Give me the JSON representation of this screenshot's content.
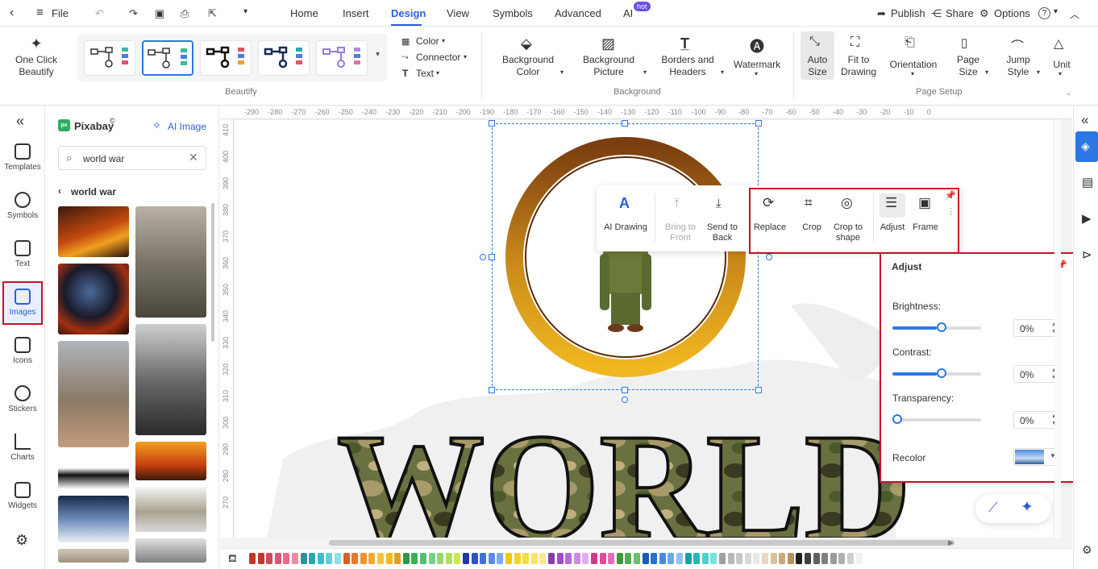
{
  "menu": {
    "file": "File",
    "tabs": [
      "Home",
      "Insert",
      "Design",
      "View",
      "Symbols",
      "Advanced",
      "AI"
    ],
    "hot_badge": "hot",
    "publish": "Publish",
    "share": "Share",
    "options": "Options",
    "help": "?"
  },
  "ribbon": {
    "one_click_beautify": [
      "One Click",
      "Beautify"
    ],
    "beautify_group": "Beautify",
    "color": "Color",
    "connector": "Connector",
    "text": "Text",
    "background_color": [
      "Background",
      "Color"
    ],
    "background_picture": [
      "Background",
      "Picture"
    ],
    "borders_headers": [
      "Borders and",
      "Headers"
    ],
    "watermark": "Watermark",
    "background_group": "Background",
    "auto_size": [
      "Auto",
      "Size"
    ],
    "fit_to_drawing": [
      "Fit to",
      "Drawing"
    ],
    "orientation": "Orientation",
    "page_size": [
      "Page",
      "Size"
    ],
    "jump_style": [
      "Jump",
      "Style"
    ],
    "unit": "Unit",
    "page_setup_group": "Page Setup"
  },
  "rail": {
    "items": [
      "Templates",
      "Symbols",
      "Text",
      "Images",
      "Icons",
      "Stickers",
      "Charts",
      "Widgets"
    ]
  },
  "panel": {
    "brand": "Pixabay",
    "ai_image": "AI Image",
    "search_value": "world war",
    "breadcrumb": "world war"
  },
  "ruler": {
    "top": [
      "-290",
      "-280",
      "-270",
      "-260",
      "-250",
      "-240",
      "-230",
      "-220",
      "-210",
      "-200",
      "-190",
      "-180",
      "-170",
      "-160",
      "-150",
      "-140",
      "-130",
      "-120",
      "-110",
      "-100",
      "-90",
      "-80",
      "-70",
      "-60",
      "-50",
      "-40",
      "-30",
      "-20",
      "-10",
      "0"
    ],
    "left": [
      "410",
      "400",
      "390",
      "380",
      "370",
      "360",
      "350",
      "340",
      "330",
      "320",
      "310",
      "300",
      "290",
      "280",
      "270"
    ]
  },
  "canvas_text": {
    "world": "WORLD"
  },
  "floatbar": {
    "ai_drawing": "AI Drawing",
    "bring_to_front": [
      "Bring to",
      "Front"
    ],
    "send_to_back": [
      "Send to",
      "Back"
    ],
    "replace": "Replace",
    "crop": "Crop",
    "crop_to_shape": [
      "Crop to",
      "shape"
    ],
    "adjust": "Adjust",
    "frame": "Frame"
  },
  "adjust": {
    "title": "Adjust",
    "brightness_label": "Brightness:",
    "brightness_value": "0%",
    "brightness_level": 0.5,
    "contrast_label": "Contrast:",
    "contrast_value": "0%",
    "contrast_level": 0.5,
    "transparency_label": "Transparency:",
    "transparency_value": "0%",
    "transparency_level": 0,
    "recolor_label": "Recolor"
  },
  "colors": {
    "accent": "#2b5fd9",
    "highlight_box": "#c8102e",
    "palette": [
      "#c0392b",
      "#c0392b",
      "#d14a5a",
      "#e05577",
      "#e86c8a",
      "#f08aa0",
      "#2f8f9d",
      "#2aa5b5",
      "#3bbccc",
      "#5fd0dc",
      "#8fe0e8",
      "#e0601b",
      "#e8782a",
      "#f0902f",
      "#f5a830",
      "#f8c040",
      "#f5b820",
      "#e0a020",
      "#2a9a4a",
      "#3ab05a",
      "#50c070",
      "#78d090",
      "#98d870",
      "#b0e060",
      "#c8e850",
      "#2438a8",
      "#2f52c8",
      "#4070e0",
      "#5a8cf0",
      "#80a8f5",
      "#f2c80f",
      "#f5d22a",
      "#f8dc40",
      "#fae26a",
      "#fce890",
      "#8a3ab0",
      "#a04cc8",
      "#b86ad8",
      "#cc8ae2",
      "#e0b0ee",
      "#d03a8a",
      "#e04aa0",
      "#ea6ab8",
      "#3a9a3a",
      "#50b050",
      "#6ac06a",
      "#1a5ab0",
      "#2a70d0",
      "#4a8ae0",
      "#6aa8ee",
      "#90c0f4",
      "#1aa0a0",
      "#2ab8b8",
      "#4ad0d0",
      "#7ae0e0",
      "#a0a0a0",
      "#b8b8b8",
      "#c8c8c8",
      "#d8d8d8",
      "#e8e8e8",
      "#e8d8c0",
      "#d8c0a0",
      "#c8a880",
      "#b89060",
      "#202020",
      "#404040",
      "#606060",
      "#808080",
      "#9a9a9a",
      "#b0b0b0",
      "#d0d0d0",
      "#f0f0f0"
    ]
  }
}
